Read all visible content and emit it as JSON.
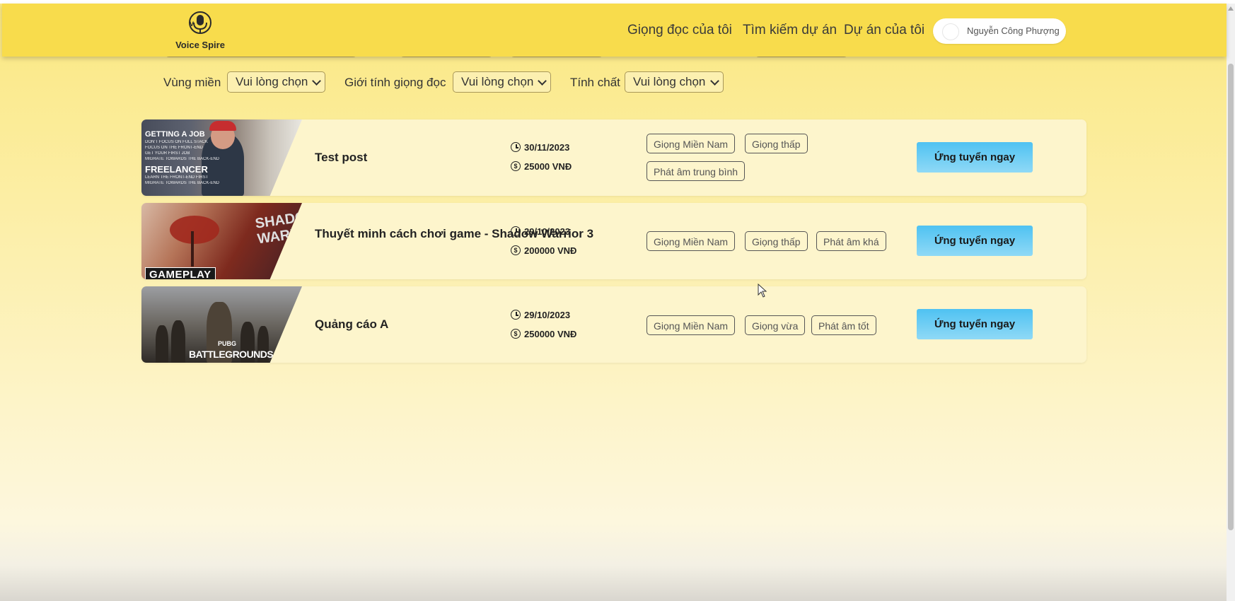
{
  "header": {
    "logo_text": "Voice Spire",
    "nav": [
      {
        "label": "Giọng đọc của tôi"
      },
      {
        "label": "Tìm kiếm dự án"
      },
      {
        "label": "Dự án của tôi"
      }
    ],
    "user_name": "Nguyễn Công Phượng"
  },
  "filters": [
    {
      "label": "Vùng miền",
      "value": "Vui lòng chọn"
    },
    {
      "label": "Giới tính giọng đọc",
      "value": "Vui lòng chọn"
    },
    {
      "label": "Tính chất",
      "value": "Vui lòng chọn"
    }
  ],
  "projects": [
    {
      "title": "Test post",
      "date": "30/11/2023",
      "price": "25000 VNĐ",
      "tags": [
        "Giọng Miền Nam",
        "Giọng thấp",
        "Phát âm trung bình"
      ],
      "thumbnail": {
        "lines": [
          "GETTING A JOB",
          "FREELANCER"
        ],
        "small_lines": [
          "DON'T FOCUS ON FULL STACK",
          "FOCUS ON THE FRONT-END",
          "GET YOUR FIRST JOB",
          "MIGRATE TOWARDS THE BACK-END",
          "LEARN THE FRONT-END FIRST",
          "MIGRATE TOWARDS THE BACK-END"
        ]
      },
      "button": "Ứng tuyển ngay"
    },
    {
      "title": "Thuyết minh cách chơi game - Shadow Warrior 3",
      "date": "29/10/2023",
      "price": "200000 VNĐ",
      "tags": [
        "Giọng Miền Nam",
        "Giọng thấp",
        "Phát âm khá"
      ],
      "thumbnail": {
        "badge": "GAMEPLAY",
        "logo_line1": "SHADOW",
        "logo_line2": "WARRIOR"
      },
      "button": "Ứng tuyển ngay"
    },
    {
      "title": "Quảng cáo A",
      "date": "29/10/2023",
      "price": "250000 VNĐ",
      "tags": [
        "Giọng Miền Nam",
        "Giọng vừa",
        "Phát âm tốt"
      ],
      "thumbnail": {
        "logo_top": "PUBG",
        "logo_main": "BATTLEGROUNDS"
      },
      "button": "Ứng tuyển ngay"
    }
  ],
  "colors": {
    "navbar": "#f8dc4c",
    "button": "#4fc2f2",
    "card": "#fdf5cc"
  }
}
